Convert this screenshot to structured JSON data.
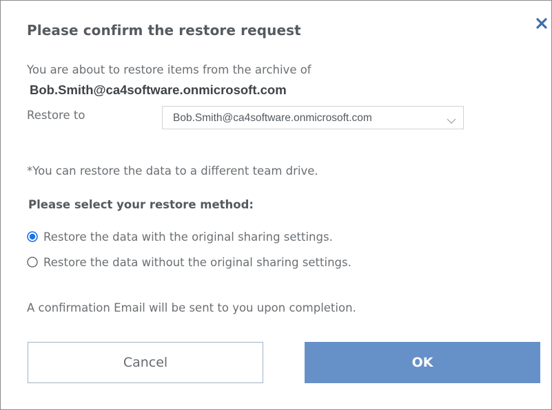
{
  "dialog": {
    "title": "Please confirm the restore request",
    "close_icon": "close-icon",
    "intro_text": "You are about to restore items from the archive of",
    "account": "Bob.Smith@ca4software.onmicrosoft.com",
    "restore_to": {
      "label": "Restore to",
      "selected_value": "Bob.Smith@ca4software.onmicrosoft.com",
      "chevron_icon": "chevron-down-icon"
    },
    "note": "*You can restore the data to a different team drive.",
    "method": {
      "heading": "Please select your restore method:",
      "options": [
        {
          "label": "Restore the data with the original sharing settings.",
          "selected": true
        },
        {
          "label": "Restore the data without the original sharing settings.",
          "selected": false
        }
      ]
    },
    "confirmation_note": "A confirmation Email will be sent to you upon completion.",
    "buttons": {
      "cancel_label": "Cancel",
      "ok_label": "OK"
    }
  },
  "colors": {
    "primary": "#6690c8",
    "radio_selected": "#1a73e8",
    "text": "#555a5f",
    "close": "#3a6fa8"
  }
}
